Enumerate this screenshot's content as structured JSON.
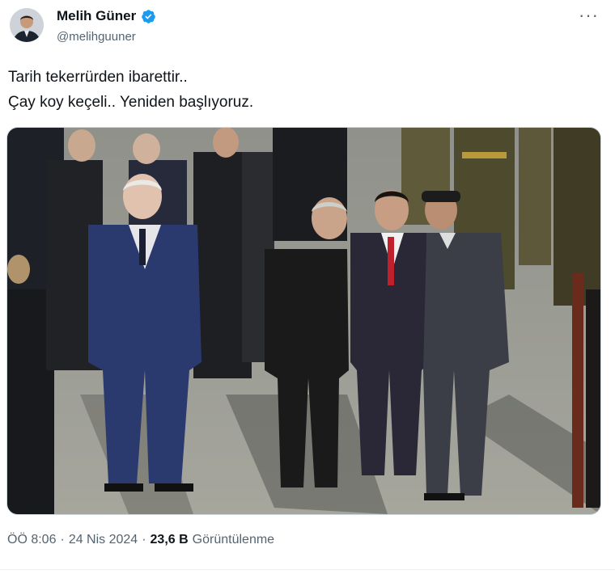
{
  "author": {
    "display_name": "Melih Güner",
    "handle": "@melihguuner",
    "verified": true,
    "avatar_icon": "profile-avatar-icon"
  },
  "menu": {
    "more_label": "···"
  },
  "tweet": {
    "lines": [
      "Tarih tekerrürden ibarettir..",
      "Çay koy keçeli.. Yeniden başlıyoruz."
    ]
  },
  "meta": {
    "time": "ÖÖ 8:06",
    "separator": "·",
    "date": "24 Nis 2024",
    "views_count": "23,6 B",
    "views_label": "Görüntülenme"
  },
  "colors": {
    "text_primary": "#0f1419",
    "text_secondary": "#536471",
    "verified_blue": "#1d9bf0",
    "border": "#cfd9de"
  }
}
